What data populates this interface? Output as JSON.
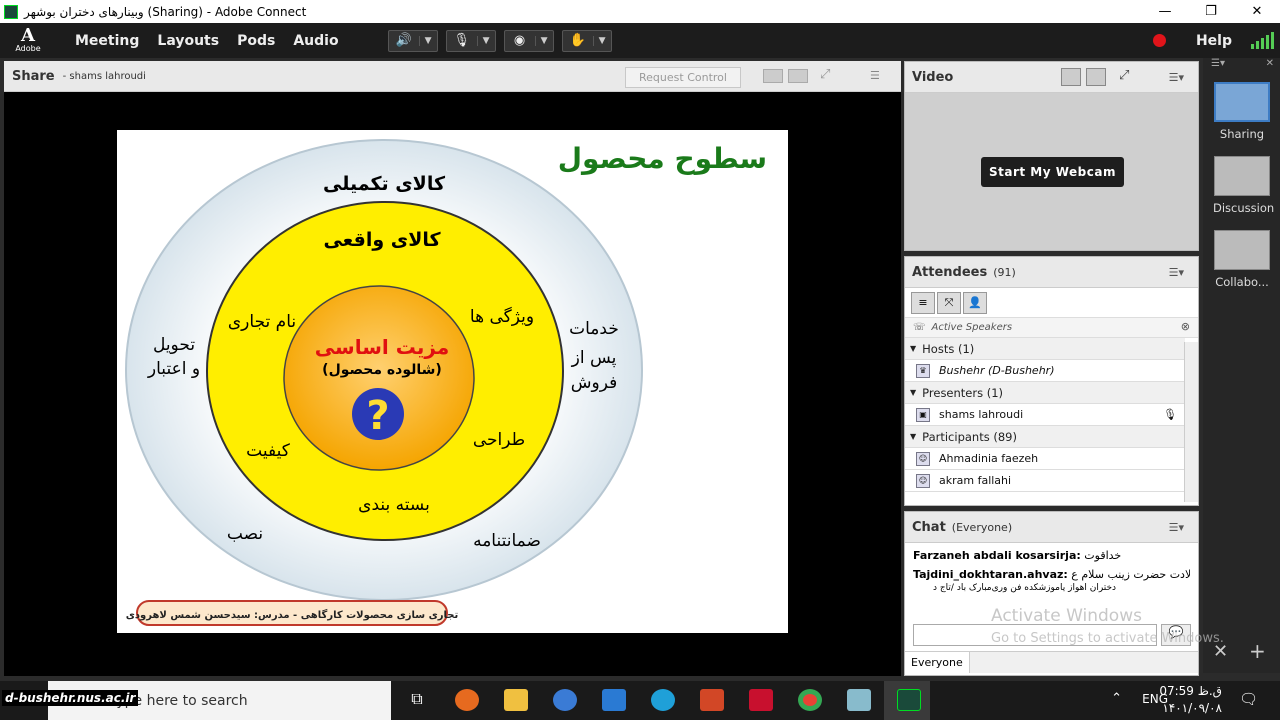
{
  "window": {
    "title": "وبینارهای دختران بوشهر (Sharing) - Adobe Connect",
    "controls": [
      "—",
      "❐",
      "✕"
    ]
  },
  "menubar": {
    "logo_text": "Adobe",
    "items": [
      "Meeting",
      "Layouts",
      "Pods",
      "Audio"
    ],
    "help": "Help"
  },
  "share": {
    "title": "Share",
    "presenter": "- shams lahroudi",
    "request_control": "Request Control"
  },
  "slide": {
    "title": "سطوح محصول",
    "outer_label": "کالای تکمیلی",
    "middle_label": "کالای واقعی",
    "core_title": "مزیت اساسی",
    "core_subtitle": "(شالوده محصول)",
    "q_mark": "?",
    "brand_name": "نام تجاری",
    "features": "ویژگی ها",
    "design": "طراحی",
    "quality": "کیفیت",
    "packaging": "بسته بندی",
    "delivery1": "تحویل",
    "delivery2": "و اعتبار",
    "after1": "خدمات",
    "after2": "پس از",
    "after3": "فروش",
    "install": "نصب",
    "warranty": "ضمانتنامه",
    "footer": "تجاری سازی محصولات کارگاهی - مدرس: سیدحسن شمس لاهرودی"
  },
  "video": {
    "title": "Video",
    "webcam_button": "Start My Webcam"
  },
  "attendees": {
    "title": "Attendees",
    "count": "(91)",
    "active_speakers": "Active Speakers",
    "groups": {
      "hosts": "Hosts (1)",
      "presenters": "Presenters (1)",
      "participants": "Participants (89)"
    },
    "hosts_list": [
      "Bushehr (D-Bushehr)"
    ],
    "presenters_list": [
      "shams lahroudi"
    ],
    "participants_list": [
      "Ahmadinia faezeh",
      "akram fallahi"
    ]
  },
  "chat": {
    "title": "Chat",
    "scope": "(Everyone)",
    "messages": [
      {
        "sender": "Farzaneh abdali kosarsirja:",
        "text": "خداقوت"
      },
      {
        "sender": "Tajdini_dokhtaran.ahvaz:",
        "text": "سی‌ولادت حضرت زینب سلام ع"
      },
      {
        "sender": "",
        "text": "دختران اهواز یاموزشکده فن وری‌مبارک باد /تاج د"
      }
    ],
    "recipient": "Everyone"
  },
  "layouts": {
    "items": [
      "Sharing",
      "Discussion",
      "Collabo..."
    ]
  },
  "watermark": {
    "line1": "Activate Windows",
    "line2": "Go to Settings to activate Windows."
  },
  "taskbar": {
    "search_placeholder": "Type here to search",
    "brand": "d-bushehr.nus.ac.ir",
    "lang": "ENG",
    "time": "07:59 ق.ظ",
    "date": "۱۴۰۱/۰۹/۰۸"
  },
  "colors": {
    "accent": "#3d7cc4",
    "record": "#e0141a",
    "slide_title": "#1a7a1a",
    "core_red": "#e01010"
  }
}
